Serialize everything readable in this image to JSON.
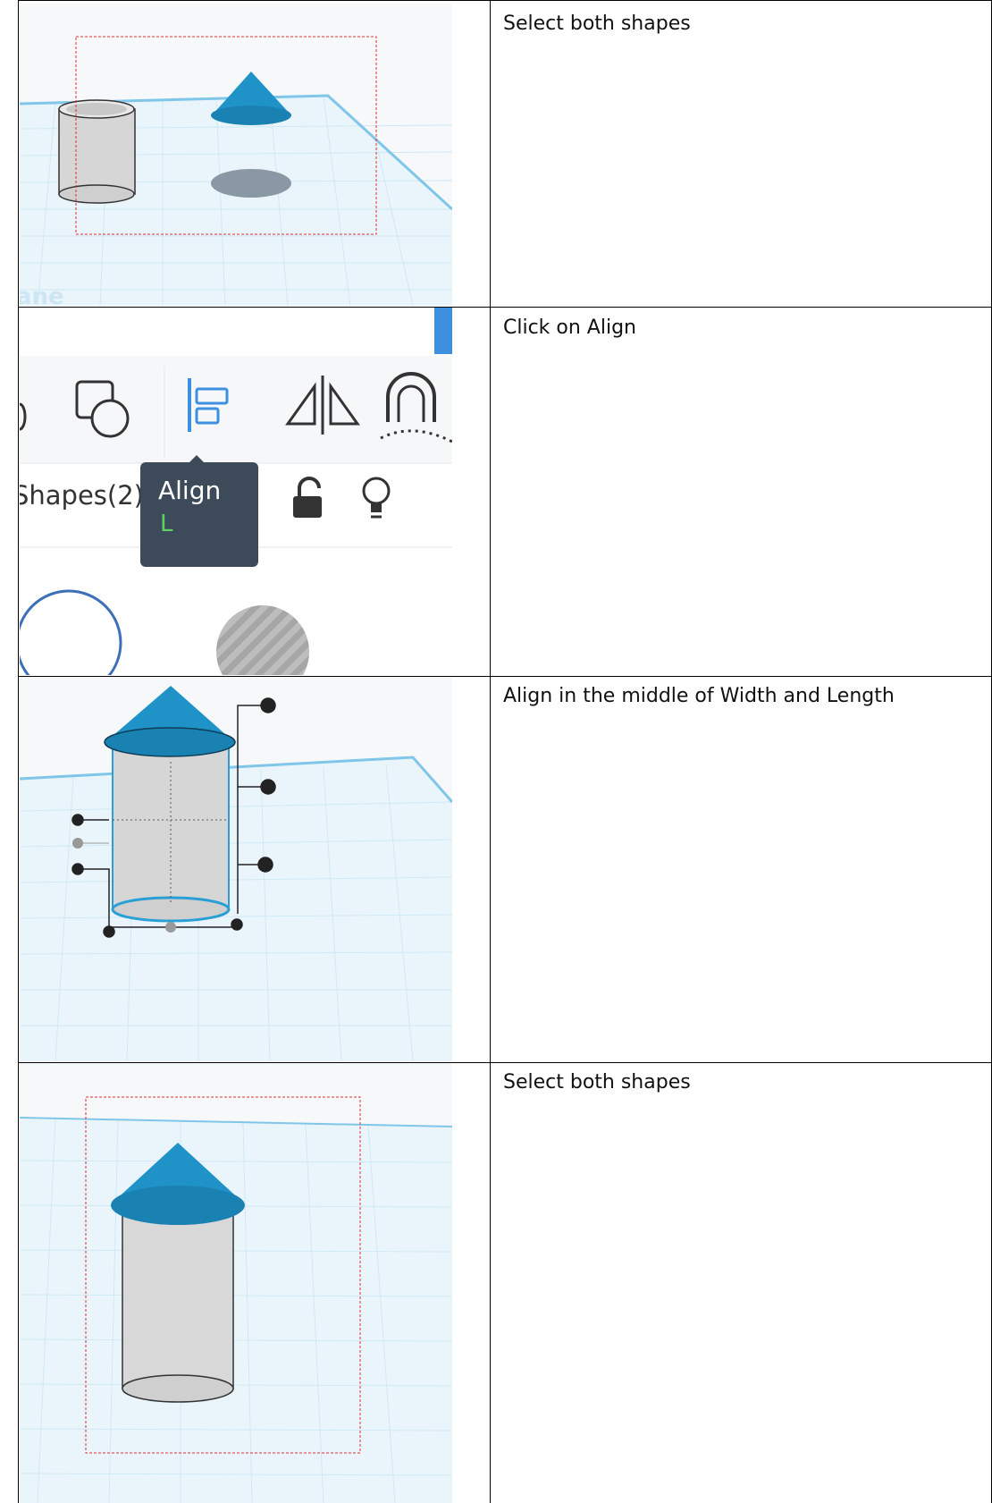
{
  "rows": [
    {
      "instruction": "Select both shapes"
    },
    {
      "instruction": "Click on Align"
    },
    {
      "instruction": "Align in the middle of Width and Length"
    },
    {
      "instruction": "Select both shapes"
    }
  ],
  "toolbar": {
    "shapes_label": "Shapes(2)",
    "tooltip_title": "Align",
    "tooltip_shortcut": "L"
  },
  "workplane_fragment": "ane",
  "colors": {
    "cone_blue": "#1f93c8",
    "cylinder_gray": "#d9d9d9",
    "grid_line": "#cfe8f5",
    "selection_red": "#e03030",
    "tooltip_bg": "#3c4a59",
    "tooltip_shortcut": "#5fd35f",
    "align_icon_blue": "#3d8fe0"
  }
}
